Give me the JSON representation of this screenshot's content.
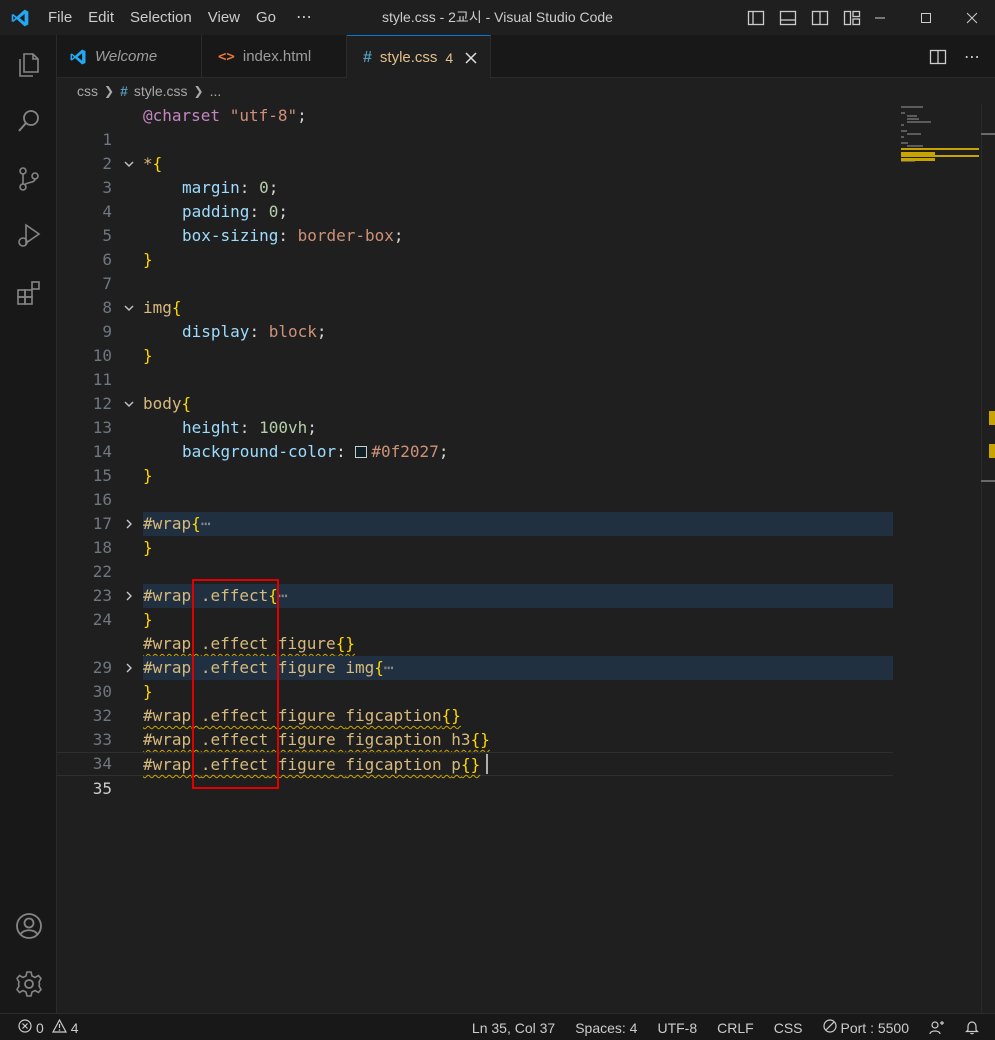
{
  "titlebar": {
    "menu": [
      "File",
      "Edit",
      "Selection",
      "View",
      "Go"
    ],
    "more": "⋯",
    "window_title": "style.css - 2교시 - Visual Studio Code",
    "accent": "#0078d4"
  },
  "tabs": [
    {
      "label": "Welcome",
      "icon": "vscode-logo-icon"
    },
    {
      "label": "index.html",
      "icon": "html-icon"
    },
    {
      "label": "style.css",
      "icon": "css-hash-icon",
      "badge": "4",
      "active": true
    }
  ],
  "breadcrumbs": {
    "folder": "css",
    "file": "style.css",
    "tail": "..."
  },
  "editor": {
    "lines": [
      {
        "n": "1"
      },
      {
        "n": "2"
      },
      {
        "n": "3"
      },
      {
        "n": "4"
      },
      {
        "n": "5"
      },
      {
        "n": "6"
      },
      {
        "n": "7"
      },
      {
        "n": "8"
      },
      {
        "n": "9"
      },
      {
        "n": "10"
      },
      {
        "n": "11"
      },
      {
        "n": "12"
      },
      {
        "n": "13"
      },
      {
        "n": "14"
      },
      {
        "n": "15"
      },
      {
        "n": "16"
      },
      {
        "n": "17"
      },
      {
        "n": "18"
      },
      {
        "n": "22"
      },
      {
        "n": "23"
      },
      {
        "n": "24"
      },
      {
        "n": "28"
      },
      {
        "n": "29"
      },
      {
        "n": "30"
      },
      {
        "n": "32"
      },
      {
        "n": "33"
      },
      {
        "n": "34"
      },
      {
        "n": "35"
      }
    ],
    "code": {
      "charset_kw": "@charset",
      "charset_val": "\"utf-8\"",
      "semi": ";",
      "star": "*",
      "open": "{",
      "close": "}",
      "margin_prop": "margin",
      "padding_prop": "padding",
      "boxsizing_prop": "box-sizing",
      "colon_sp": ": ",
      "zero": "0",
      "border_box": "border-box",
      "img_sel": "img",
      "display_prop": "display",
      "block": "block",
      "body_sel": "body",
      "height_prop": "height",
      "height_val": "100vh",
      "bg_prop": "background-color",
      "bg_val": "#0f2027",
      "wrap": "#wrap",
      "effect": ".effect",
      "figure": "figure",
      "img": "img",
      "figcaption": "figcaption",
      "h3": "h3",
      "p": "p",
      "empty_braces": "{}",
      "ellipsis": "⋯",
      "sp": " "
    }
  },
  "statusbar": {
    "errors": "0",
    "warnings": "4",
    "position": "Ln 35, Col 37",
    "spaces": "Spaces: 4",
    "encoding": "UTF-8",
    "eol": "CRLF",
    "language": "CSS",
    "port": "Port : 5500"
  },
  "colors": {
    "warning": "#cca700",
    "highlight_box": "#e00000"
  }
}
